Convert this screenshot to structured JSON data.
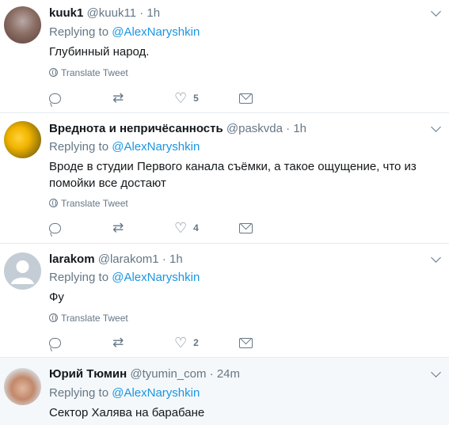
{
  "tweets": [
    {
      "name": "kuuk1",
      "handle": "@kuuk11",
      "time": "1h",
      "replying_prefix": "Replying to",
      "replying_to": "@AlexNaryshkin",
      "text": "Глубинный народ.",
      "translate": "Translate Tweet",
      "likes": "5"
    },
    {
      "name": "Вреднота и непричёсанность",
      "handle": "@paskvda",
      "time": "1h",
      "replying_prefix": "Replying to",
      "replying_to": "@AlexNaryshkin",
      "text": "Вроде в студии Первого канала съёмки, а такое ощущение, что из помойки все достают",
      "translate": "Translate Tweet",
      "likes": "4"
    },
    {
      "name": "larakom",
      "handle": "@larakom1",
      "time": "1h",
      "replying_prefix": "Replying to",
      "replying_to": "@AlexNaryshkin",
      "text": "Фу",
      "translate": "Translate Tweet",
      "likes": "2"
    },
    {
      "name": "Юрий Тюмин",
      "handle": "@tyumin_com",
      "time": "24m",
      "replying_prefix": "Replying to",
      "replying_to": "@AlexNaryshkin",
      "text": "Сектор Халява на барабане"
    }
  ],
  "separator": "·",
  "icons": {
    "reply": "reply-icon",
    "retweet": "retweet-icon",
    "like": "heart-icon",
    "dm": "envelope-icon",
    "caret": "chevron-down-icon",
    "globe": "globe-icon"
  },
  "colors": {
    "link": "#1b95e0",
    "muted": "#657786",
    "text": "#14171a",
    "highlight_bg": "#f5f8fa"
  }
}
